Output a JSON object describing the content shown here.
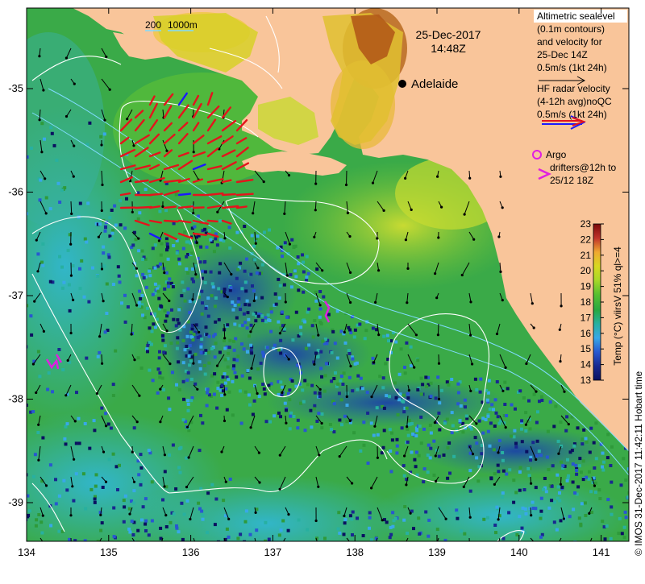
{
  "map": {
    "datetime_line1": "25-Dec-2017",
    "datetime_line2": "14:48Z",
    "city": "Adelaide",
    "depth_contour_labels": [
      "200",
      "1000m"
    ],
    "lon_ticks": [
      "134",
      "135",
      "136",
      "137",
      "138",
      "139",
      "140",
      "141"
    ],
    "lat_ticks": [
      "-35",
      "-36",
      "-37",
      "-38",
      "-39"
    ],
    "colors": {
      "land": "#f9c59a",
      "radar_red": "#e4141c",
      "radar_blue": "#1a1aff",
      "argo_magenta": "#e020e0",
      "contour_white": "#ffffff",
      "depth_cyan": "#7fdcff"
    }
  },
  "legend": {
    "altimetric_lines": [
      "Altimetric sealevel",
      "(0.1m contours)",
      "and velocity for",
      "25-Dec 14Z",
      "0.5m/s (1kt 24h)"
    ],
    "hf_lines": [
      "HF radar velocity",
      "(4-12h avg)noQC",
      "0.5m/s (1kt 24h)"
    ],
    "argo_lines": [
      "Argo",
      "drifters@12h to",
      "25/12 18Z"
    ]
  },
  "colorbar": {
    "ticks": [
      "23",
      "22",
      "21",
      "20",
      "19",
      "18",
      "17",
      "16",
      "15",
      "14",
      "13"
    ],
    "label": "Temp (°C) viirsV 51% ql>=4",
    "gradient": [
      "#7a0a0a",
      "#c0322a",
      "#e8682a",
      "#f0a830",
      "#d8d820",
      "#a8d828",
      "#58c030",
      "#28a840",
      "#28b0a0",
      "#38a8e8",
      "#2858d0",
      "#182890",
      "#0a1060"
    ]
  },
  "credit": "© IMOS 31-Dec-2017 11:42:11 Hobart time"
}
